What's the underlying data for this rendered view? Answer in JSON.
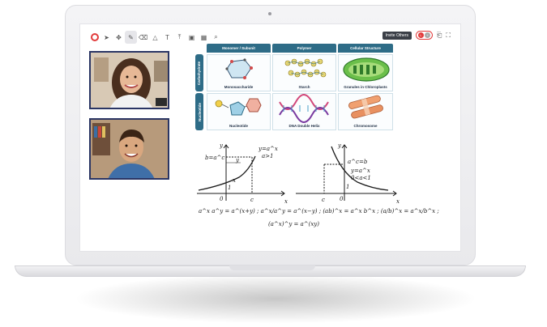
{
  "toolbar": {
    "invite_label": "Invite Others",
    "participants": [
      "L",
      "+"
    ]
  },
  "videos": [
    {
      "name": "participant-woman"
    },
    {
      "name": "participant-man"
    }
  ],
  "table": {
    "columns": [
      "Monomer / Subunit",
      "Polymer",
      "Cellular Structure"
    ],
    "rows": [
      "Carbohydrate",
      "Nucleotide"
    ],
    "captions": [
      [
        "Monosaccharide",
        "Starch",
        "Granules in Chloroplasts"
      ],
      [
        "Nucleotide",
        "DNA Double Helix",
        "Chromosome"
      ]
    ]
  },
  "graph_left": {
    "label_y": "y",
    "label_x": "x",
    "curve_label": "y=a^x",
    "curve_sub": "a>1",
    "point_label": "b=a^c",
    "mark_y": "y",
    "mark_x": "x",
    "origin": "0",
    "c_label": "c",
    "one_label": "1"
  },
  "graph_right": {
    "label_y": "y",
    "label_x": "x",
    "point_label": "a^c=b",
    "curve_label": "y=a^x",
    "curve_sub": "0<a<1",
    "origin": "0",
    "c_label": "c",
    "one_label": "1"
  },
  "formula_line1": "a^x a^y = a^(x+y) ;  a^x/a^y = a^(x−y) ;  (ab)^x = a^x b^x ;  (a/b)^x = a^x/b^x ;",
  "formula_line2": "(a^x)^y = a^(xy)"
}
